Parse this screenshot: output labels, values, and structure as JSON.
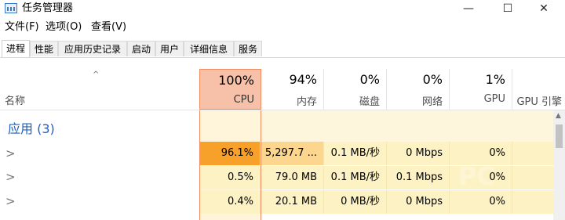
{
  "window": {
    "title": "任务管理器"
  },
  "window_controls": {
    "minimize": "—",
    "maximize": "☐",
    "close": "✕"
  },
  "menu": [
    "文件(F)",
    "选项(O)",
    "查看(V)"
  ],
  "tabs": [
    "进程",
    "性能",
    "应用历史记录",
    "启动",
    "用户",
    "详细信息",
    "服务"
  ],
  "active_tab": "进程",
  "header": {
    "sort_indicator": "^",
    "name_label": "名称",
    "columns": [
      {
        "pct": "100%",
        "label": "CPU"
      },
      {
        "pct": "94%",
        "label": "内存"
      },
      {
        "pct": "0%",
        "label": "磁盘"
      },
      {
        "pct": "0%",
        "label": "网络"
      },
      {
        "pct": "1%",
        "label": "GPU"
      },
      {
        "pct": "",
        "label": "GPU 引擎"
      }
    ]
  },
  "group": {
    "label": "应用 (3)"
  },
  "rows": [
    {
      "chevron": ">",
      "cpu": "96.1%",
      "mem": "5,297.7 ...",
      "disk": "0.1 MB/秒",
      "net": "0 Mbps",
      "gpu": "0%"
    },
    {
      "chevron": ">",
      "cpu": "0.5%",
      "mem": "79.0 MB",
      "disk": "0.1 MB/秒",
      "net": "0.1 Mbps",
      "gpu": "0%"
    },
    {
      "chevron": ">",
      "cpu": "0.4%",
      "mem": "20.1 MB",
      "disk": "0 MB/秒",
      "net": "0 Mbps",
      "gpu": "0%"
    }
  ],
  "watermark": "PC",
  "colors": {
    "cpu_header_bg": "#f6c1a8",
    "cpu_high": "#f7a12b",
    "mem_high": "#fcd58e",
    "cell_low": "#fdf2c4",
    "cell_very_low": "#fef8de",
    "group_text": "#1f5fbf"
  }
}
